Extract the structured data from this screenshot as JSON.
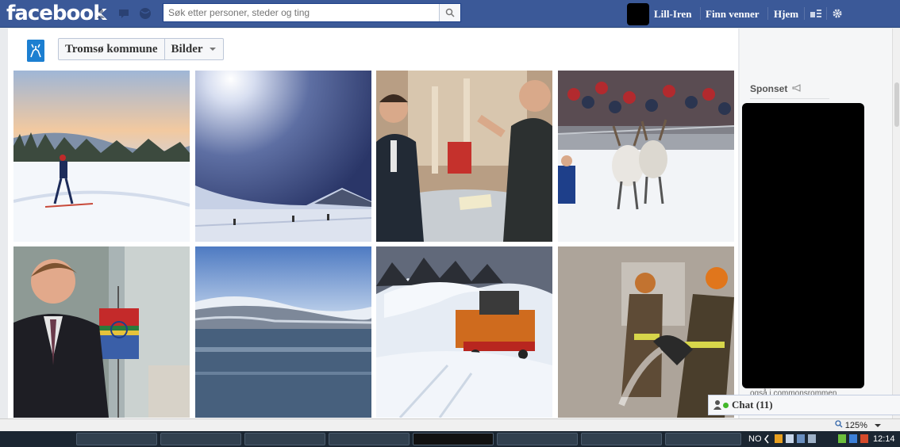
{
  "header": {
    "logo": "facebook",
    "search_placeholder": "Søk etter personer, steder og ting",
    "user_name": "Lill-Iren",
    "find_friends": "Finn venner",
    "home": "Hjem"
  },
  "page": {
    "name": "Tromsø kommune",
    "section": "Bilder"
  },
  "sidebar": {
    "sponsored_label": "Sponset",
    "ad_caption": "også i commonsrommen"
  },
  "chat": {
    "label": "Chat (11)"
  },
  "status": {
    "zoom": "125%"
  },
  "taskbar": {
    "lang": "NO",
    "time": "12:14"
  }
}
